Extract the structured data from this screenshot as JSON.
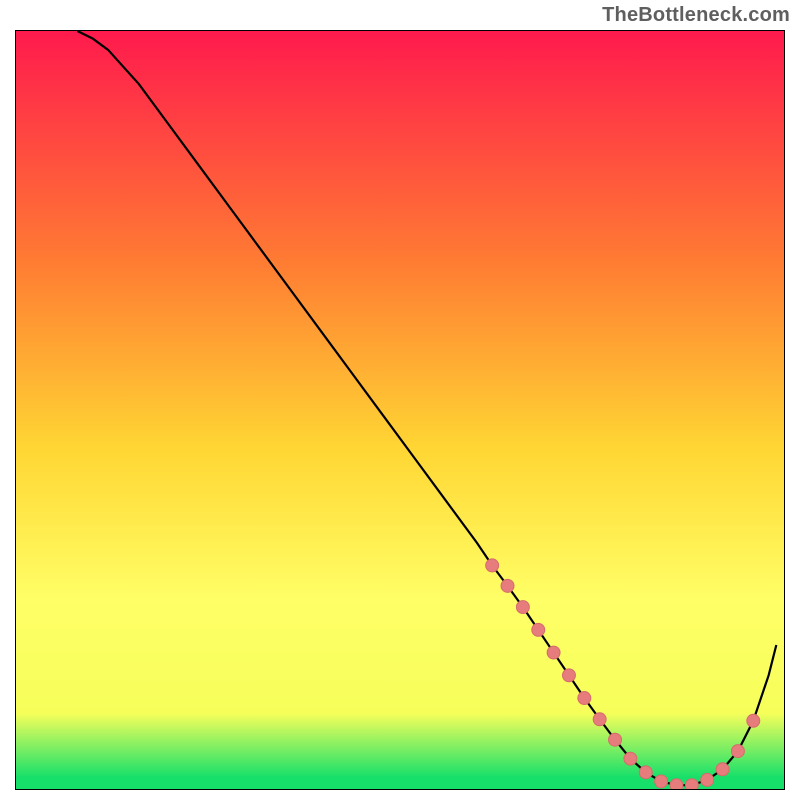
{
  "attribution": "TheBottleneck.com",
  "colors": {
    "gradient_top": "#ff1a4d",
    "gradient_mid_upper": "#ff7a33",
    "gradient_mid": "#ffd633",
    "gradient_lower": "#ffff66",
    "gradient_yellowband": "#f6ff5a",
    "gradient_green": "#16e06a",
    "curve": "#000000",
    "marker_fill": "#e77c7c",
    "marker_stroke": "#d66b6b"
  },
  "chart_data": {
    "type": "line",
    "title": "",
    "xlabel": "",
    "ylabel": "",
    "xlim": [
      0,
      100
    ],
    "ylim": [
      0,
      100
    ],
    "curve": {
      "x": [
        8,
        10,
        12,
        16,
        20,
        24,
        28,
        32,
        36,
        40,
        44,
        48,
        52,
        56,
        60,
        62,
        64,
        66,
        68,
        70,
        72,
        74,
        76,
        78,
        80,
        82,
        84,
        86,
        88,
        90,
        92,
        94,
        96,
        98,
        99
      ],
      "y": [
        100,
        99,
        97.5,
        93,
        87.5,
        82,
        76.5,
        71,
        65.5,
        60,
        54.5,
        49,
        43.5,
        38,
        32.5,
        29.5,
        26.8,
        24,
        21,
        18,
        15,
        12,
        9.2,
        6.5,
        4,
        2.2,
        1,
        0.5,
        0.5,
        1.2,
        2.6,
        5,
        9,
        15,
        19
      ]
    },
    "markers": {
      "x": [
        62,
        64,
        66,
        68,
        70,
        72,
        74,
        76,
        78,
        80,
        82,
        84,
        86,
        88,
        90,
        92,
        94,
        96
      ],
      "y": [
        29.5,
        26.8,
        24,
        21,
        18,
        15,
        12,
        9.2,
        6.5,
        4,
        2.2,
        1,
        0.5,
        0.5,
        1.2,
        2.6,
        5,
        9
      ]
    }
  }
}
